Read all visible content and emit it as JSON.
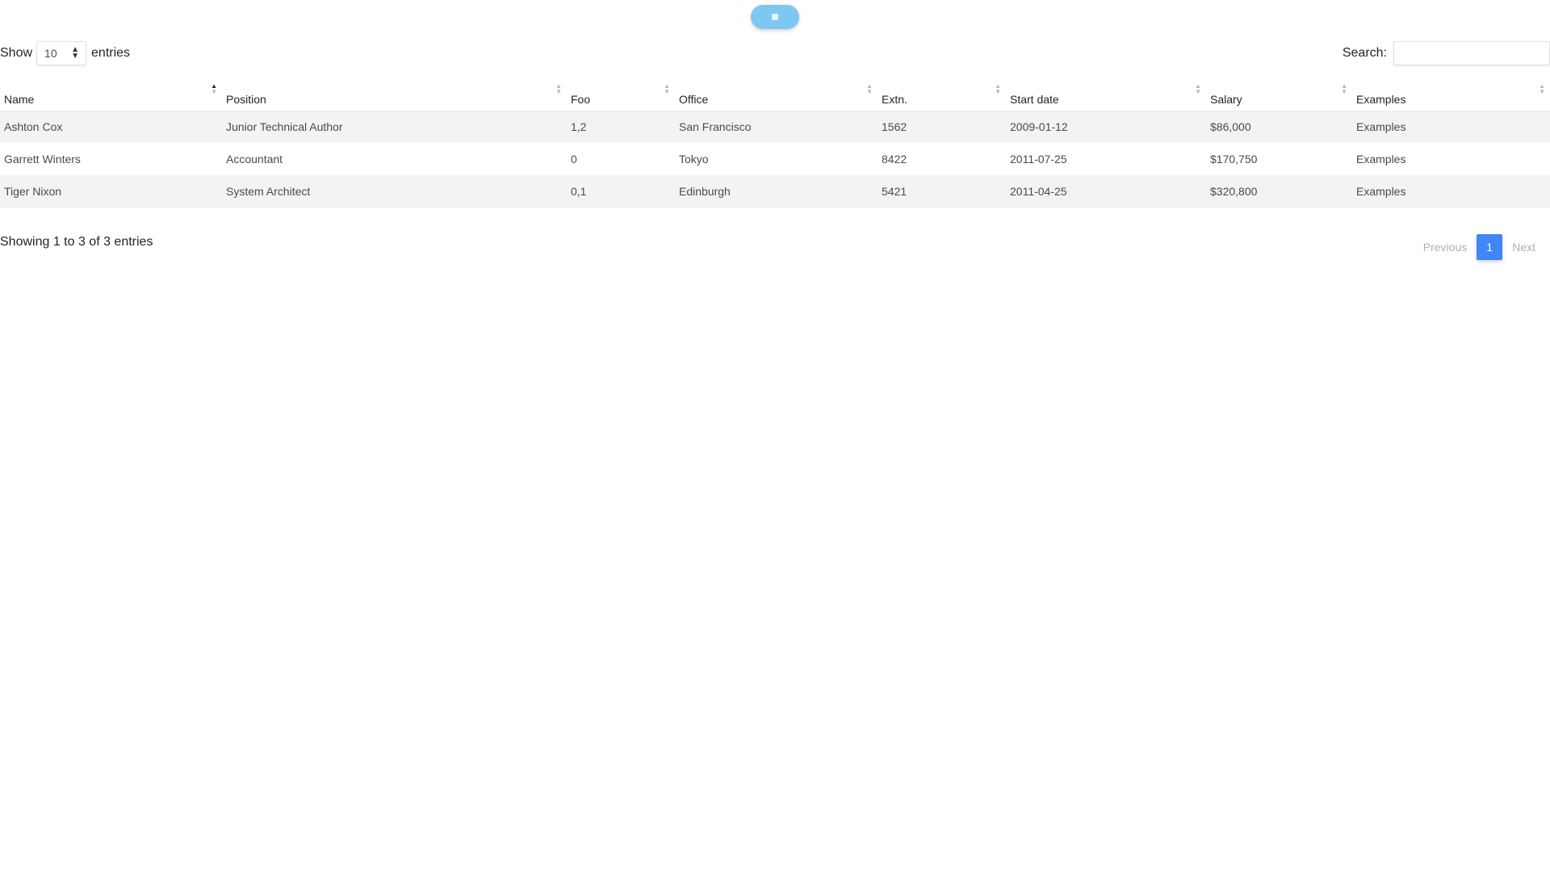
{
  "top_button": {
    "icon": "square-icon",
    "color": "#7dc8f2"
  },
  "length": {
    "prefix": "Show",
    "value": "10",
    "suffix": "entries"
  },
  "search": {
    "label": "Search:",
    "value": "",
    "placeholder": ""
  },
  "table": {
    "columns": [
      "Name",
      "Position",
      "Foo",
      "Office",
      "Extn.",
      "Start date",
      "Salary",
      "Examples"
    ],
    "sorted_column": "Name",
    "sort_direction": "ascending",
    "rows": [
      [
        "Ashton Cox",
        "Junior Technical Author",
        "1,2",
        "San Francisco",
        "1562",
        "2009-01-12",
        "$86,000",
        "Examples"
      ],
      [
        "Garrett Winters",
        "Accountant",
        "0",
        "Tokyo",
        "8422",
        "2011-07-25",
        "$170,750",
        "Examples"
      ],
      [
        "Tiger Nixon",
        "System Architect",
        "0,1",
        "Edinburgh",
        "5421",
        "2011-04-25",
        "$320,800",
        "Examples"
      ]
    ]
  },
  "info": "Showing 1 to 3 of 3 entries",
  "pagination": {
    "previous": "Previous",
    "current": "1",
    "next": "Next",
    "accent": "#4285f4"
  }
}
